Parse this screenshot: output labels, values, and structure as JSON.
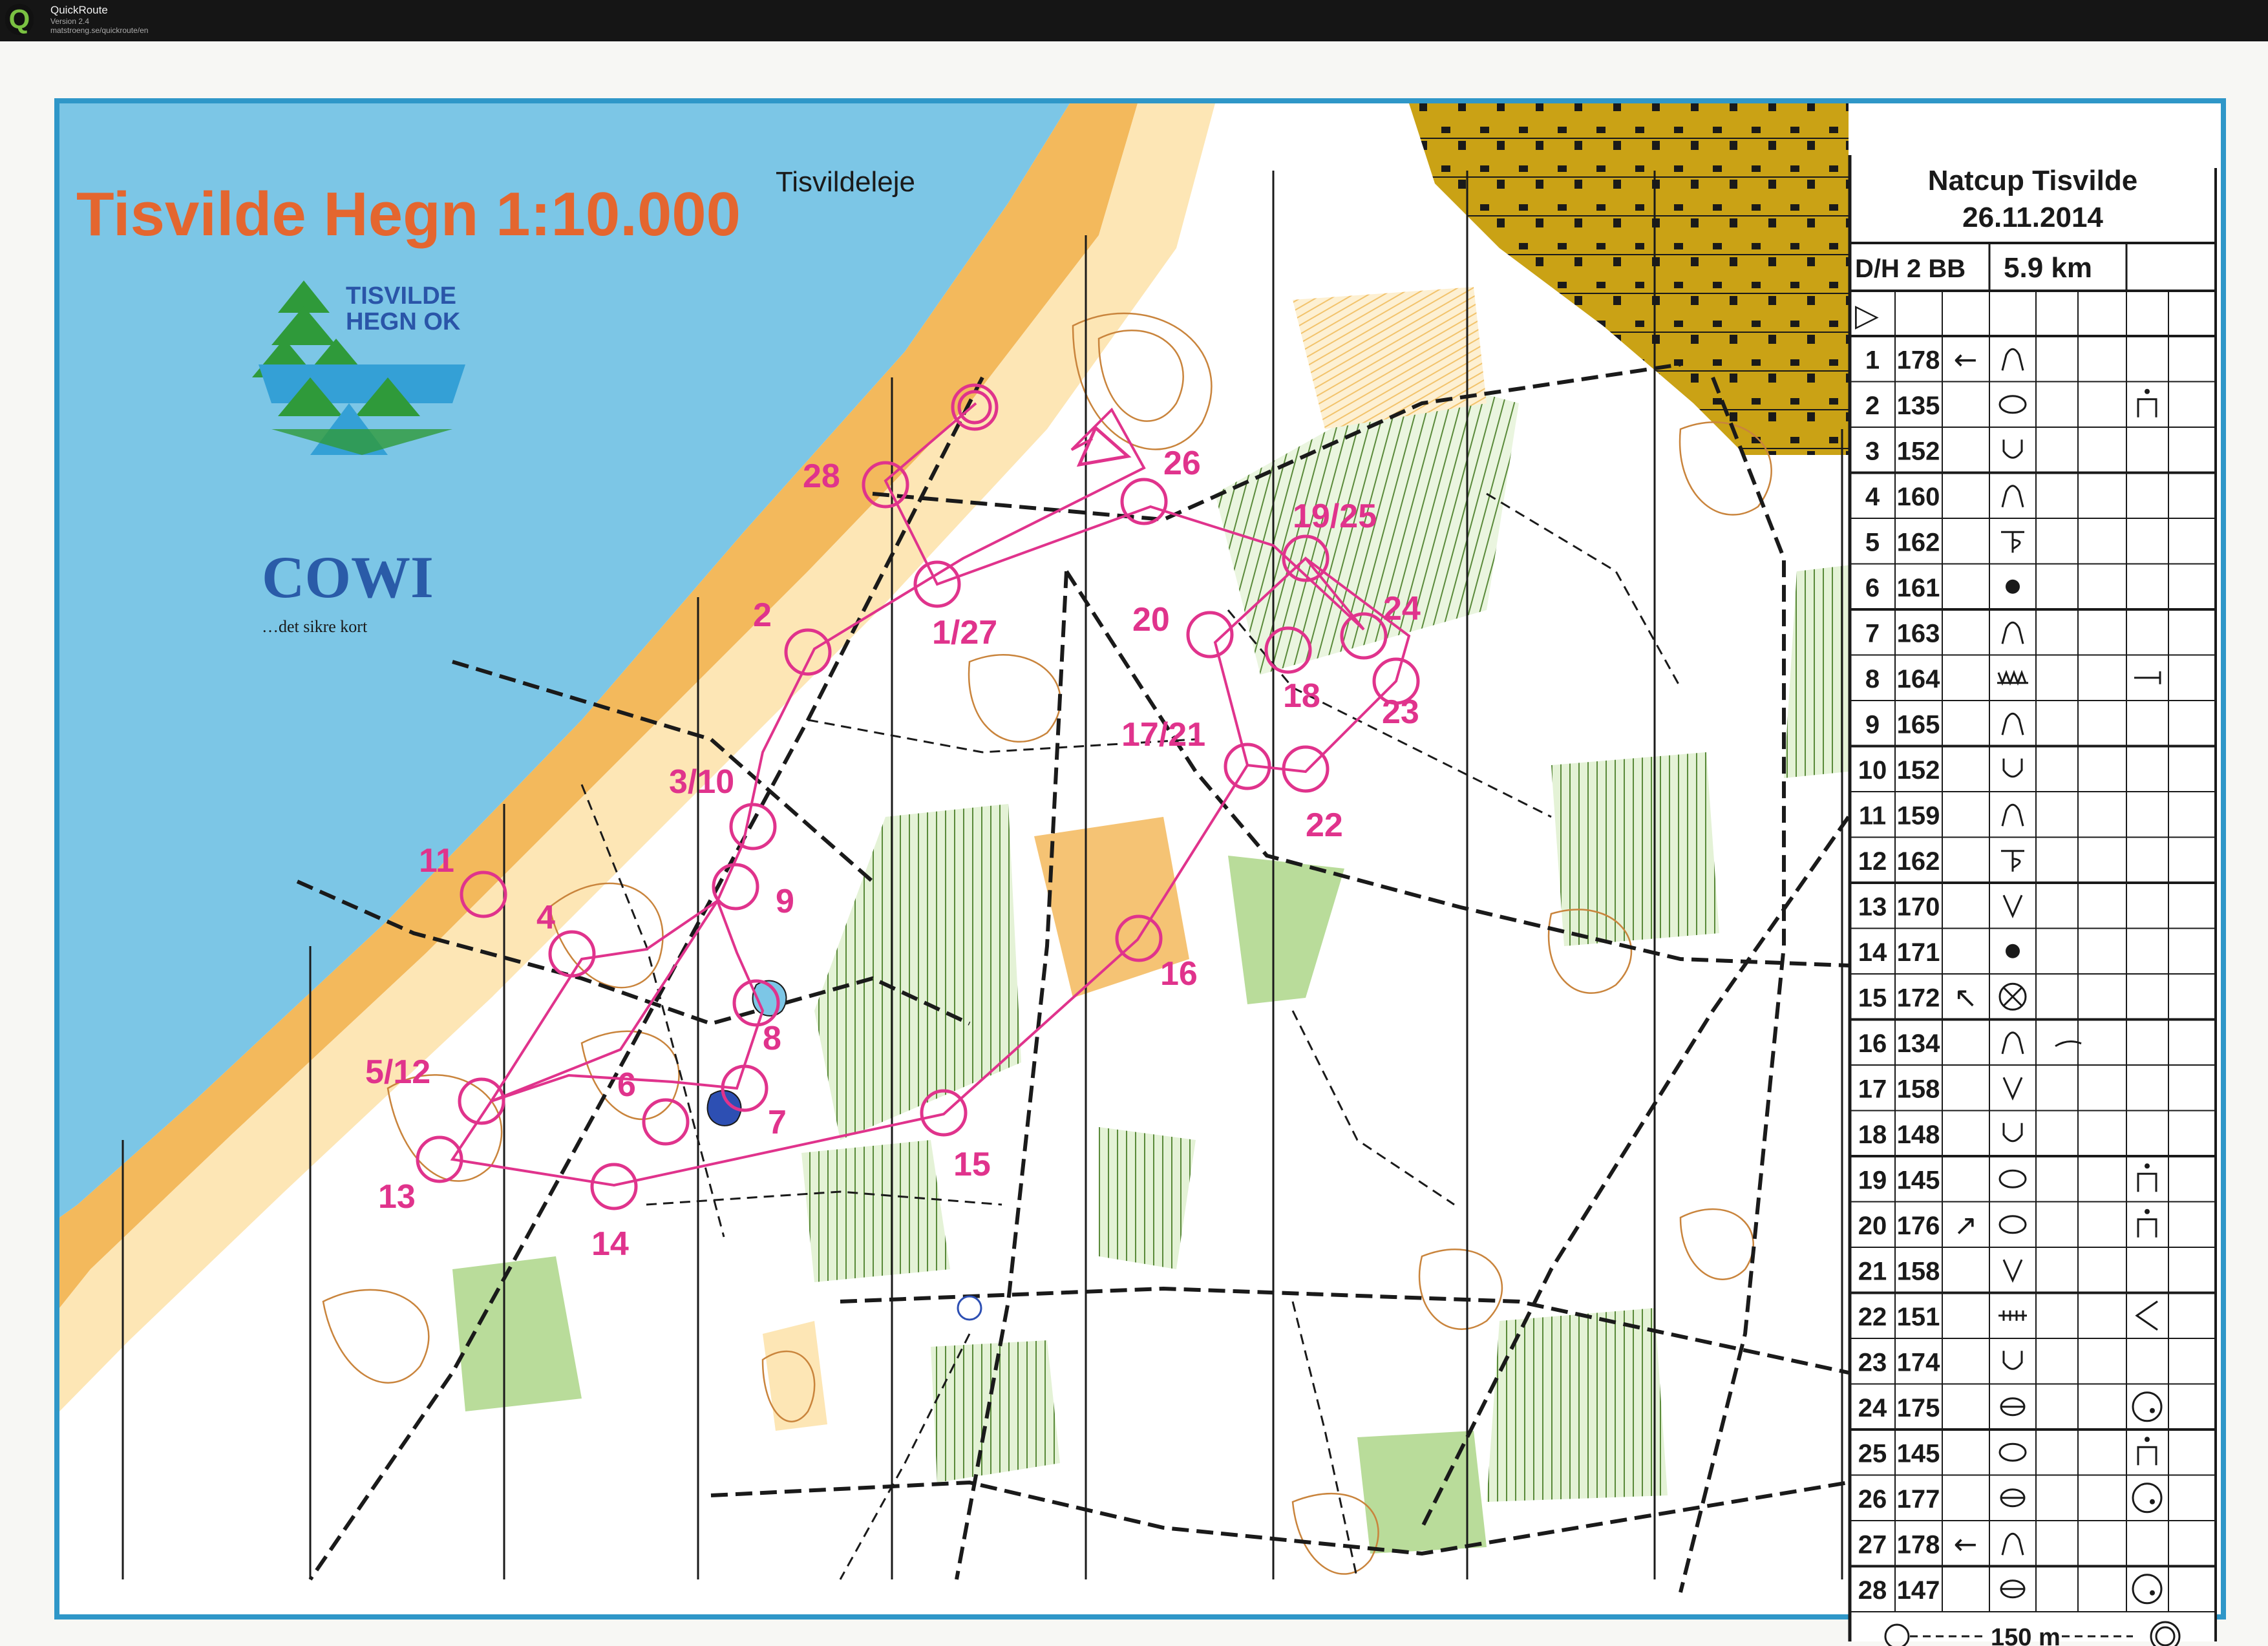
{
  "window": {
    "app_name": "QuickRoute",
    "version": "Version 2.4",
    "url": "matstroeng.se/quickroute/en"
  },
  "map": {
    "title": "Tisvilde Hegn 1:10.000",
    "place_label": "Tisvildeleje",
    "club_logo_line1": "TISVILDE",
    "club_logo_line2": "HEGN OK",
    "sponsor_name": "COWI",
    "sponsor_tagline": "…det sikre kort",
    "colors": {
      "sea": "#7cc6e6",
      "open_land": "#f3b95c",
      "rough_open": "#fde6b5",
      "green": "#b9dc9a",
      "urban": "#caa215",
      "course": "#e0338c",
      "contours": "#c9843c",
      "frame": "#2f97c8"
    }
  },
  "course": {
    "controls": [
      {
        "label": "1/27"
      },
      {
        "label": "2"
      },
      {
        "label": "3/10"
      },
      {
        "label": "4"
      },
      {
        "label": "5/12"
      },
      {
        "label": "6"
      },
      {
        "label": "7"
      },
      {
        "label": "8"
      },
      {
        "label": "9"
      },
      {
        "label": "11"
      },
      {
        "label": "13"
      },
      {
        "label": "14"
      },
      {
        "label": "15"
      },
      {
        "label": "16"
      },
      {
        "label": "17/21"
      },
      {
        "label": "18"
      },
      {
        "label": "19/25"
      },
      {
        "label": "20"
      },
      {
        "label": "22"
      },
      {
        "label": "23"
      },
      {
        "label": "24"
      },
      {
        "label": "26"
      },
      {
        "label": "28"
      }
    ]
  },
  "description_sheet": {
    "event_name": "Natcup Tisvilde",
    "date": "26.11.2014",
    "class": "D/H 2 BB",
    "length": "5.9 km",
    "start_symbol": "▷",
    "rows": [
      {
        "num": "1",
        "code": "178",
        "dir": "←",
        "feature": "knoll",
        "extra": ""
      },
      {
        "num": "2",
        "code": "135",
        "dir": "",
        "feature": "pit",
        "extra": "foot"
      },
      {
        "num": "3",
        "code": "152",
        "dir": "",
        "feature": "depression",
        "extra": ""
      },
      {
        "num": "4",
        "code": "160",
        "dir": "",
        "feature": "knoll",
        "extra": ""
      },
      {
        "num": "5",
        "code": "162",
        "dir": "",
        "feature": "spur",
        "extra": ""
      },
      {
        "num": "6",
        "code": "161",
        "dir": "",
        "feature": "dot",
        "extra": ""
      },
      {
        "num": "7",
        "code": "163",
        "dir": "",
        "feature": "knoll",
        "extra": ""
      },
      {
        "num": "8",
        "code": "164",
        "dir": "",
        "feature": "dense",
        "extra": "end"
      },
      {
        "num": "9",
        "code": "165",
        "dir": "",
        "feature": "knoll",
        "extra": ""
      },
      {
        "num": "10",
        "code": "152",
        "dir": "",
        "feature": "depression",
        "extra": ""
      },
      {
        "num": "11",
        "code": "159",
        "dir": "",
        "feature": "knoll",
        "extra": ""
      },
      {
        "num": "12",
        "code": "162",
        "dir": "",
        "feature": "spur",
        "extra": ""
      },
      {
        "num": "13",
        "code": "170",
        "dir": "",
        "feature": "gully",
        "extra": ""
      },
      {
        "num": "14",
        "code": "171",
        "dir": "",
        "feature": "dot",
        "extra": ""
      },
      {
        "num": "15",
        "code": "172",
        "dir": "↖",
        "feature": "crossed-circle",
        "extra": ""
      },
      {
        "num": "16",
        "code": "134",
        "dir": "",
        "feature": "knoll",
        "extra": "arc"
      },
      {
        "num": "17",
        "code": "158",
        "dir": "",
        "feature": "gully",
        "extra": ""
      },
      {
        "num": "18",
        "code": "148",
        "dir": "",
        "feature": "depression",
        "extra": ""
      },
      {
        "num": "19",
        "code": "145",
        "dir": "",
        "feature": "pit",
        "extra": "foot"
      },
      {
        "num": "20",
        "code": "176",
        "dir": "↗",
        "feature": "pit",
        "extra": "foot"
      },
      {
        "num": "21",
        "code": "158",
        "dir": "",
        "feature": "gully",
        "extra": ""
      },
      {
        "num": "22",
        "code": "151",
        "dir": "",
        "feature": "fence",
        "extra": "angle"
      },
      {
        "num": "23",
        "code": "174",
        "dir": "",
        "feature": "depression",
        "extra": ""
      },
      {
        "num": "24",
        "code": "175",
        "dir": "",
        "feature": "theta",
        "extra": "circle-dot"
      },
      {
        "num": "25",
        "code": "145",
        "dir": "",
        "feature": "pit",
        "extra": "foot"
      },
      {
        "num": "26",
        "code": "177",
        "dir": "",
        "feature": "theta",
        "extra": "circle-dot"
      },
      {
        "num": "27",
        "code": "178",
        "dir": "←",
        "feature": "knoll",
        "extra": ""
      },
      {
        "num": "28",
        "code": "147",
        "dir": "",
        "feature": "theta",
        "extra": "circle-dot"
      }
    ],
    "finish": "150 m"
  }
}
